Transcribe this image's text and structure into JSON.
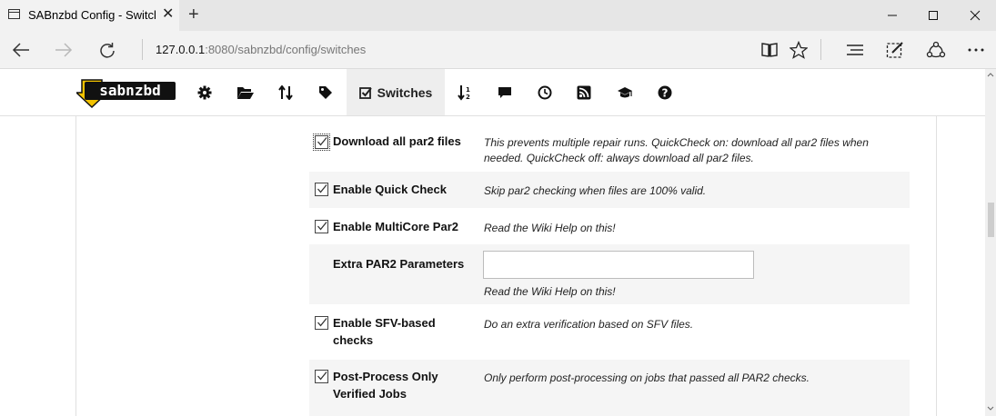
{
  "browser": {
    "tab_title": "SABnzbd Config - Switcl",
    "url_host": "127.0.0.1",
    "url_path": ":8080/sabnzbd/config/switches"
  },
  "app": {
    "logo_text": "sabnzbd",
    "active_nav": "Switches"
  },
  "settings": [
    {
      "label": "Download all par2 files",
      "checked": true,
      "description": "This prevents multiple repair runs. QuickCheck on: download all par2 files when needed. QuickCheck off: always download all par2 files."
    },
    {
      "label": "Enable Quick Check",
      "checked": true,
      "description": "Skip par2 checking when files are 100% valid."
    },
    {
      "label": "Enable MultiCore Par2",
      "checked": true,
      "description": "Read the Wiki Help on this!"
    },
    {
      "label": "Extra PAR2 Parameters",
      "input_value": "",
      "description": "Read the Wiki Help on this!"
    },
    {
      "label": "Enable SFV-based checks",
      "checked": true,
      "description": "Do an extra verification based on SFV files."
    },
    {
      "label": "Post-Process Only Verified Jobs",
      "checked": true,
      "description": "Only perform post-processing on jobs that passed all PAR2 checks."
    }
  ]
}
